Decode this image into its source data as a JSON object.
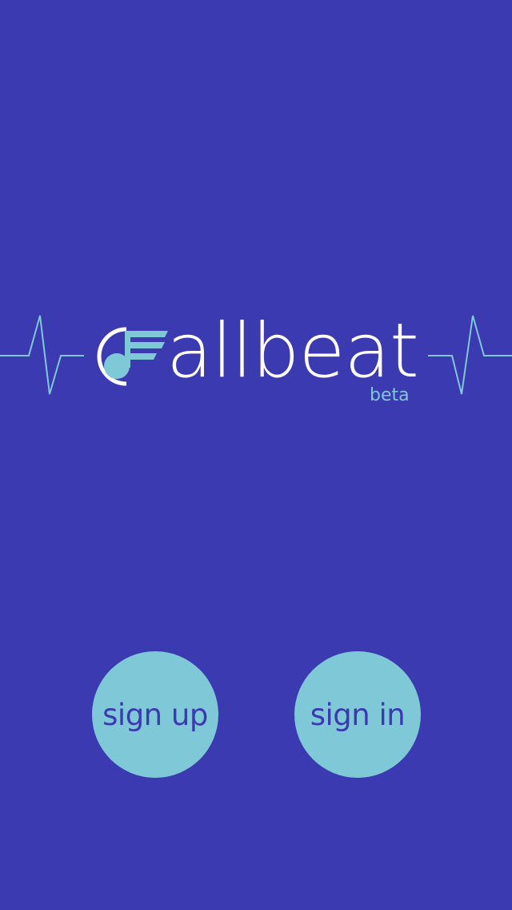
{
  "app": {
    "wordmark": "allbeat",
    "tag": "beta"
  },
  "actions": {
    "sign_up_label": "sign up",
    "sign_in_label": "sign in"
  },
  "colors": {
    "background": "#3b3ab0",
    "accent": "#7fc8d8",
    "text": "#ffffff"
  },
  "icons": {
    "logo_mark": "music-note-c-icon",
    "pulse": "heartbeat-line-icon"
  }
}
